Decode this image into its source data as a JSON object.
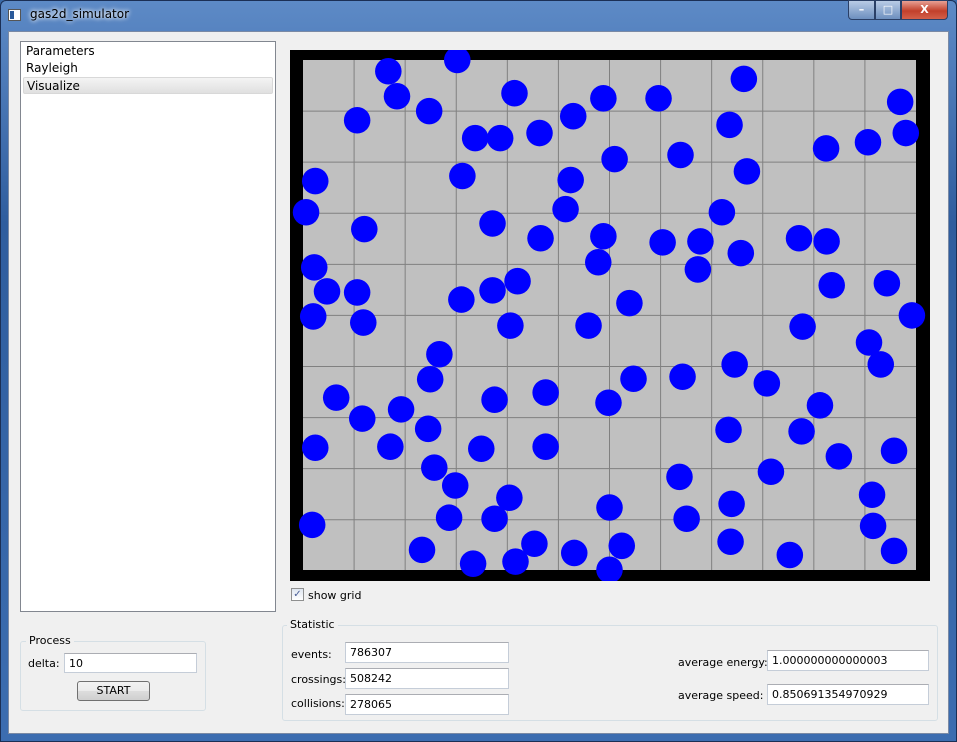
{
  "window": {
    "title": "gas2d_simulator",
    "controls": {
      "minimize": "–",
      "maximize": "□",
      "close": "X"
    }
  },
  "sidebar": {
    "items": [
      {
        "label": "Parameters",
        "selected": false
      },
      {
        "label": "Rayleigh",
        "selected": false
      },
      {
        "label": "Visualize",
        "selected": true
      }
    ]
  },
  "process": {
    "title": "Process",
    "delta_label": "delta:",
    "delta_value": "10",
    "start_label": "START"
  },
  "visualize": {
    "show_grid_label": "show grid",
    "show_grid_checked": true,
    "check_mark": "✓",
    "particle_color": "#0000ff",
    "background_color": "#c0c0c0",
    "wall_color": "#000000",
    "grid_color": "#808080",
    "box_size": [
      12,
      10
    ],
    "grid_step": 1,
    "particle_radius": 0.25,
    "particles": [
      [
        3.02,
        0.0
      ],
      [
        1.67,
        0.22
      ],
      [
        8.63,
        0.37
      ],
      [
        1.84,
        0.71
      ],
      [
        2.47,
        1.0
      ],
      [
        4.14,
        0.65
      ],
      [
        5.88,
        0.75
      ],
      [
        6.96,
        0.75
      ],
      [
        11.69,
        0.82
      ],
      [
        1.06,
        1.18
      ],
      [
        5.29,
        1.1
      ],
      [
        8.35,
        1.27
      ],
      [
        3.37,
        1.53
      ],
      [
        3.86,
        1.53
      ],
      [
        4.63,
        1.43
      ],
      [
        11.8,
        1.43
      ],
      [
        10.24,
        1.73
      ],
      [
        11.06,
        1.61
      ],
      [
        6.1,
        1.94
      ],
      [
        7.39,
        1.86
      ],
      [
        0.24,
        2.37
      ],
      [
        3.12,
        2.27
      ],
      [
        5.24,
        2.35
      ],
      [
        8.69,
        2.18
      ],
      [
        0.06,
        2.98
      ],
      [
        5.14,
        2.92
      ],
      [
        8.2,
        2.98
      ],
      [
        3.71,
        3.2
      ],
      [
        1.2,
        3.31
      ],
      [
        4.65,
        3.49
      ],
      [
        5.88,
        3.45
      ],
      [
        7.04,
        3.57
      ],
      [
        7.78,
        3.55
      ],
      [
        9.71,
        3.49
      ],
      [
        10.25,
        3.55
      ],
      [
        0.22,
        4.06
      ],
      [
        5.78,
        3.96
      ],
      [
        8.57,
        3.78
      ],
      [
        7.73,
        4.1
      ],
      [
        0.47,
        4.53
      ],
      [
        1.06,
        4.55
      ],
      [
        4.2,
        4.33
      ],
      [
        3.71,
        4.51
      ],
      [
        3.1,
        4.69
      ],
      [
        6.39,
        4.76
      ],
      [
        10.35,
        4.41
      ],
      [
        11.43,
        4.37
      ],
      [
        0.2,
        5.02
      ],
      [
        1.18,
        5.14
      ],
      [
        4.06,
        5.2
      ],
      [
        5.59,
        5.2
      ],
      [
        9.78,
        5.22
      ],
      [
        11.92,
        5.0
      ],
      [
        11.08,
        5.53
      ],
      [
        2.67,
        5.76
      ],
      [
        11.31,
        5.96
      ],
      [
        8.45,
        5.96
      ],
      [
        2.49,
        6.25
      ],
      [
        6.47,
        6.24
      ],
      [
        7.43,
        6.2
      ],
      [
        9.08,
        6.33
      ],
      [
        0.65,
        6.61
      ],
      [
        3.75,
        6.65
      ],
      [
        4.75,
        6.51
      ],
      [
        5.98,
        6.71
      ],
      [
        10.12,
        6.76
      ],
      [
        1.16,
        7.02
      ],
      [
        1.92,
        6.84
      ],
      [
        2.45,
        7.22
      ],
      [
        8.33,
        7.24
      ],
      [
        9.76,
        7.27
      ],
      [
        0.24,
        7.59
      ],
      [
        1.71,
        7.57
      ],
      [
        3.49,
        7.61
      ],
      [
        4.75,
        7.57
      ],
      [
        10.49,
        7.76
      ],
      [
        11.57,
        7.65
      ],
      [
        2.57,
        7.98
      ],
      [
        7.37,
        8.16
      ],
      [
        9.16,
        8.06
      ],
      [
        2.98,
        8.33
      ],
      [
        4.04,
        8.57
      ],
      [
        8.39,
        8.69
      ],
      [
        11.14,
        8.51
      ],
      [
        0.18,
        9.1
      ],
      [
        2.86,
        8.96
      ],
      [
        3.75,
        8.98
      ],
      [
        6.0,
        8.76
      ],
      [
        7.51,
        8.98
      ],
      [
        11.16,
        9.12
      ],
      [
        4.53,
        9.47
      ],
      [
        6.24,
        9.51
      ],
      [
        8.37,
        9.43
      ],
      [
        2.33,
        9.59
      ],
      [
        5.31,
        9.65
      ],
      [
        9.53,
        9.69
      ],
      [
        11.57,
        9.61
      ],
      [
        3.33,
        9.86
      ],
      [
        4.16,
        9.82
      ],
      [
        6.0,
        9.98
      ]
    ]
  },
  "statistic": {
    "title": "Statistic",
    "events_label": "events:",
    "events": "786307",
    "crossings_label": "crossings:",
    "crossings": "508242",
    "collisions_label": "collisions:",
    "collisions": "278065",
    "avg_energy_label": "average energy:",
    "avg_energy": "1.000000000000003",
    "avg_speed_label": "average speed:",
    "avg_speed": "0.850691354970929"
  }
}
